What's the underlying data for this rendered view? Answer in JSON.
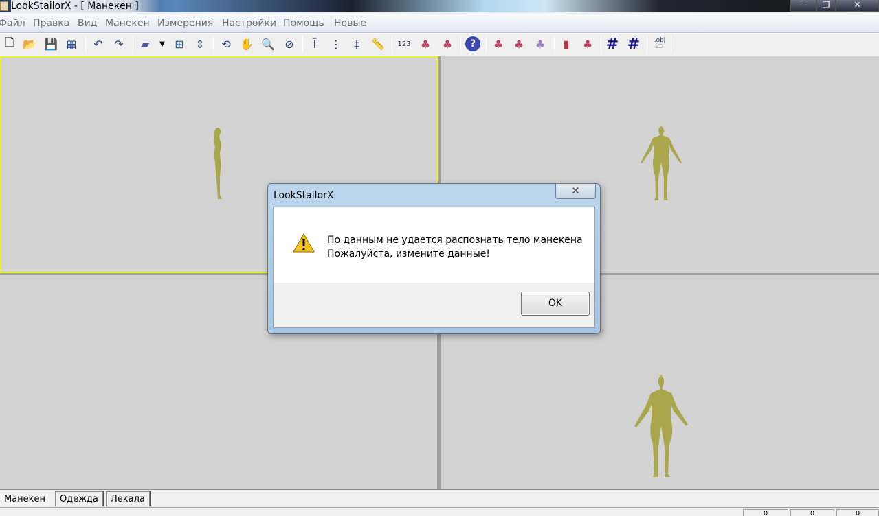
{
  "window": {
    "title": "LookStailorX - [ Манекен    ]"
  },
  "menu": [
    "Файл",
    "Правка",
    "Вид",
    "Манекен",
    "Измерения",
    "Настройки",
    "Помощь",
    "Новые"
  ],
  "toolbar": {
    "icons": [
      "new-file",
      "open-folder",
      "save",
      "save-all",
      "undo",
      "redo",
      "view-model",
      "dropdown",
      "layout",
      "fit-figure",
      "rotate",
      "pan-hand",
      "zoom",
      "zoom-extent",
      "measure-vertical",
      "measure-dotted",
      "measure-split",
      "ruler",
      "dimension-123",
      "mannequin-points",
      "mannequin-add",
      "help",
      "mannequin-height",
      "mannequin-edit",
      "mannequin-girth",
      "mannequin-front",
      "mannequin-markers",
      "grid",
      "grid-measure",
      "open-obj"
    ],
    "obj_label": ".obj",
    "dim_label": "123"
  },
  "tabs": [
    "Манекен",
    "Одежда",
    "Лекала"
  ],
  "status": [
    "0",
    "0",
    "0"
  ],
  "dialog": {
    "title": "LookStailorX",
    "line1": "По данным не удается распознать тело манекена",
    "line2": "Пожалуйста, измените данные!",
    "ok": "OK",
    "close": "✕"
  },
  "colors": {
    "figure": "#a9a64c",
    "active_border": "#f0f020"
  }
}
